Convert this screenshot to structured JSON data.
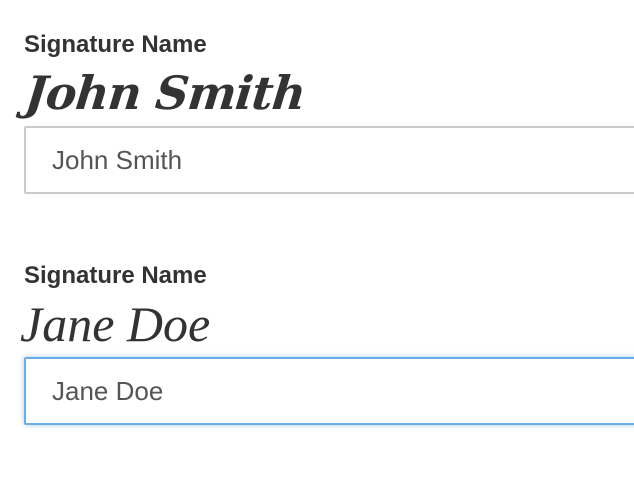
{
  "fields": [
    {
      "label": "Signature Name",
      "signature_preview": "John Smith",
      "input_value": "John Smith",
      "focused": false
    },
    {
      "label": "Signature Name",
      "signature_preview": "Jane Doe",
      "input_value": "Jane Doe",
      "focused": true
    }
  ],
  "colors": {
    "text": "#333333",
    "input_border": "#cccccc",
    "focus_border": "#66afe9"
  }
}
